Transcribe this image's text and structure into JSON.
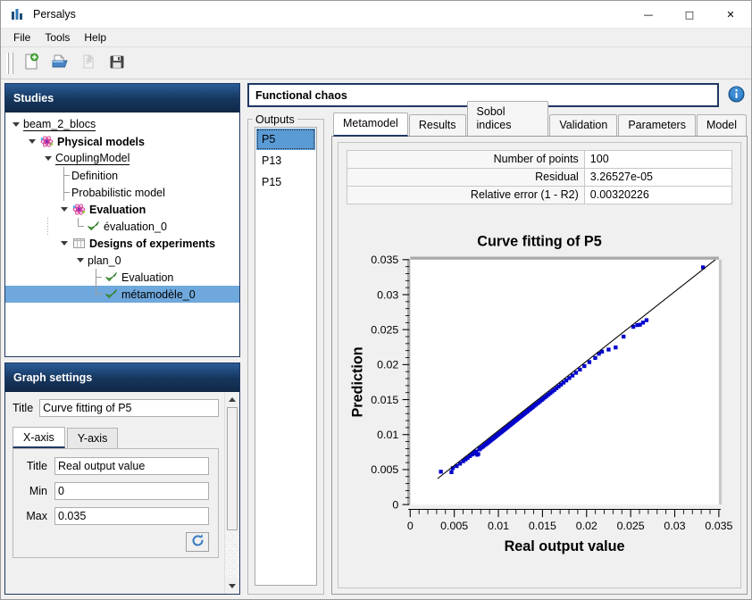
{
  "window": {
    "title": "Persalys",
    "app_icon": "bar-chart-icon",
    "controls": {
      "minimize": "—",
      "maximize": "□",
      "close": "✕"
    }
  },
  "menubar": {
    "items": [
      "File",
      "Tools",
      "Help"
    ]
  },
  "toolbar": {
    "buttons": [
      {
        "name": "new-study-button",
        "icon": "new-document-icon",
        "enabled": true
      },
      {
        "name": "open-study-button",
        "icon": "open-folder-icon",
        "enabled": true
      },
      {
        "name": "import-script-button",
        "icon": "import-script-icon",
        "enabled": false
      },
      {
        "name": "save-study-button",
        "icon": "floppy-save-icon",
        "enabled": true
      }
    ]
  },
  "sidebar": {
    "header": "Studies",
    "tree": [
      {
        "label": "beam_2_blocs",
        "depth": 0,
        "bold": false,
        "underline": true,
        "arrow": true,
        "icon": "none",
        "connector": "none",
        "selected": false
      },
      {
        "label": "Physical models",
        "depth": 1,
        "bold": true,
        "underline": false,
        "arrow": true,
        "icon": "atom-icon",
        "connector": "none",
        "selected": false
      },
      {
        "label": "CouplingModel",
        "depth": 2,
        "bold": false,
        "underline": true,
        "arrow": true,
        "icon": "none",
        "connector": "none",
        "selected": false
      },
      {
        "label": "Definition",
        "depth": 3,
        "bold": false,
        "underline": false,
        "arrow": false,
        "icon": "none",
        "connector": "tee",
        "selected": false
      },
      {
        "label": "Probabilistic model",
        "depth": 3,
        "bold": false,
        "underline": false,
        "arrow": false,
        "icon": "none",
        "connector": "tee",
        "selected": false
      },
      {
        "label": "Evaluation",
        "depth": 3,
        "bold": true,
        "underline": false,
        "arrow": true,
        "icon": "atom-icon",
        "connector": "none",
        "selected": false
      },
      {
        "label": "évaluation_0",
        "depth": 4,
        "bold": false,
        "underline": false,
        "arrow": false,
        "icon": "check-icon",
        "connector": "ell",
        "dotted": true,
        "selected": false
      },
      {
        "label": "Designs of experiments",
        "depth": 3,
        "bold": true,
        "underline": false,
        "arrow": true,
        "icon": "table-icon",
        "connector": "none",
        "selected": false
      },
      {
        "label": "plan_0",
        "depth": 4,
        "bold": false,
        "underline": false,
        "arrow": true,
        "icon": "none",
        "connector": "none",
        "selected": false
      },
      {
        "label": "Evaluation",
        "depth": 5,
        "bold": false,
        "underline": false,
        "arrow": false,
        "icon": "check-icon",
        "connector": "tee",
        "selected": false
      },
      {
        "label": "métamodèle_0",
        "depth": 5,
        "bold": false,
        "underline": false,
        "arrow": false,
        "icon": "check-icon",
        "connector": "ell",
        "selected": true
      }
    ]
  },
  "graph_settings": {
    "header": "Graph settings",
    "title_label": "Title",
    "title_value": "Curve fitting of P5",
    "tabs": [
      {
        "label": "X-axis",
        "active": true
      },
      {
        "label": "Y-axis",
        "active": false
      }
    ],
    "fields": [
      {
        "label": "Title",
        "value": "Real output value"
      },
      {
        "label": "Min",
        "value": "0"
      },
      {
        "label": "Max",
        "value": "0.035"
      }
    ],
    "refresh_icon": "refresh-circular-arrow-icon"
  },
  "main": {
    "study_title": "Functional chaos",
    "info_icon": "info-circle-icon",
    "outputs": {
      "legend": "Outputs",
      "items": [
        {
          "label": "P5",
          "selected": true
        },
        {
          "label": "P13",
          "selected": false
        },
        {
          "label": "P15",
          "selected": false
        }
      ]
    },
    "tabs": [
      {
        "label": "Metamodel",
        "active": true
      },
      {
        "label": "Results",
        "active": false
      },
      {
        "label": "Sobol indices",
        "active": false
      },
      {
        "label": "Validation",
        "active": false
      },
      {
        "label": "Parameters",
        "active": false
      },
      {
        "label": "Model",
        "active": false
      }
    ],
    "results_table": {
      "rows": [
        {
          "key": "Number of points",
          "value": "100"
        },
        {
          "key": "Residual",
          "value": "3.26527e-05"
        },
        {
          "key": "Relative error (1 - R2)",
          "value": "0.00320226"
        }
      ]
    }
  },
  "chart_data": {
    "type": "scatter",
    "title": "Curve fitting of P5",
    "xlabel": "Real output value",
    "ylabel": "Prediction",
    "xlim": [
      0,
      0.035
    ],
    "ylim": [
      0,
      0.035
    ],
    "xticks": [
      0,
      0.005,
      0.01,
      0.015,
      0.02,
      0.025,
      0.03,
      0.035
    ],
    "yticks": [
      0,
      0.005,
      0.01,
      0.015,
      0.02,
      0.025,
      0.03,
      0.035
    ],
    "xticklabels": [
      "0",
      "0.005",
      "0.01",
      "0.015",
      "0.02",
      "0.025",
      "0.03",
      "0.035"
    ],
    "yticklabels": [
      "0",
      "0.005",
      "0.01",
      "0.015",
      "0.02",
      "0.025",
      "0.03",
      "0.035"
    ],
    "minor_ticks_per_major": 5,
    "grid": false,
    "legend": null,
    "point_color": "#0000cc",
    "point_size": 4,
    "line_color": "#000000",
    "series": [
      {
        "name": "points",
        "x": [
          0.00348,
          0.00468,
          0.00483,
          0.00527,
          0.00565,
          0.00601,
          0.00628,
          0.00652,
          0.00678,
          0.00702,
          0.00718,
          0.00735,
          0.00748,
          0.0076,
          0.00772,
          0.00784,
          0.00796,
          0.00812,
          0.00826,
          0.0084,
          0.00852,
          0.00864,
          0.00876,
          0.00888,
          0.009,
          0.00911,
          0.00922,
          0.00934,
          0.00946,
          0.00957,
          0.00968,
          0.00979,
          0.0099,
          0.01001,
          0.01013,
          0.01026,
          0.01038,
          0.0105,
          0.01062,
          0.01074,
          0.01086,
          0.01098,
          0.0111,
          0.01122,
          0.01134,
          0.01146,
          0.01158,
          0.0117,
          0.01183,
          0.01196,
          0.01209,
          0.01222,
          0.01235,
          0.01248,
          0.01262,
          0.01276,
          0.0129,
          0.01304,
          0.01318,
          0.01332,
          0.01347,
          0.01362,
          0.01377,
          0.01392,
          0.01408,
          0.01424,
          0.0144,
          0.01457,
          0.01474,
          0.01492,
          0.0151,
          0.01529,
          0.01548,
          0.01568,
          0.01589,
          0.01611,
          0.01634,
          0.01658,
          0.01683,
          0.0171,
          0.01739,
          0.0177,
          0.01804,
          0.0184,
          0.0188,
          0.01925,
          0.01975,
          0.02032,
          0.02098,
          0.0214,
          0.02175,
          0.0225,
          0.0233,
          0.0242,
          0.0253,
          0.02575,
          0.02605,
          0.0264,
          0.0268,
          0.0332
        ],
        "y": [
          0.0047,
          0.00463,
          0.0052,
          0.0055,
          0.00585,
          0.0062,
          0.00645,
          0.00668,
          0.00693,
          0.00716,
          0.00731,
          0.00746,
          0.00758,
          0.00712,
          0.00722,
          0.0079,
          0.00802,
          0.00818,
          0.0083,
          0.00845,
          0.00857,
          0.00868,
          0.0088,
          0.00892,
          0.00904,
          0.00915,
          0.00926,
          0.00938,
          0.0095,
          0.00961,
          0.00972,
          0.00983,
          0.00994,
          0.01005,
          0.01017,
          0.0103,
          0.01042,
          0.01054,
          0.01066,
          0.01078,
          0.0109,
          0.01102,
          0.01114,
          0.01126,
          0.01138,
          0.0115,
          0.01162,
          0.01174,
          0.01187,
          0.012,
          0.01213,
          0.01226,
          0.01239,
          0.01252,
          0.01266,
          0.0128,
          0.01294,
          0.01308,
          0.01322,
          0.01336,
          0.01351,
          0.01366,
          0.01381,
          0.01396,
          0.01412,
          0.01428,
          0.01444,
          0.01461,
          0.01478,
          0.01496,
          0.01514,
          0.01533,
          0.01552,
          0.01572,
          0.01593,
          0.01615,
          0.01638,
          0.01662,
          0.01687,
          0.01714,
          0.01743,
          0.01774,
          0.01808,
          0.01844,
          0.01884,
          0.01929,
          0.01979,
          0.02036,
          0.02095,
          0.02155,
          0.02185,
          0.02215,
          0.02245,
          0.024,
          0.0254,
          0.02565,
          0.0257,
          0.026,
          0.02635,
          0.0339
        ],
        "type": "scatter"
      },
      {
        "name": "identity-line",
        "x": [
          0.0031,
          0.0346
        ],
        "y": [
          0.0037,
          0.035
        ],
        "type": "line"
      }
    ]
  }
}
